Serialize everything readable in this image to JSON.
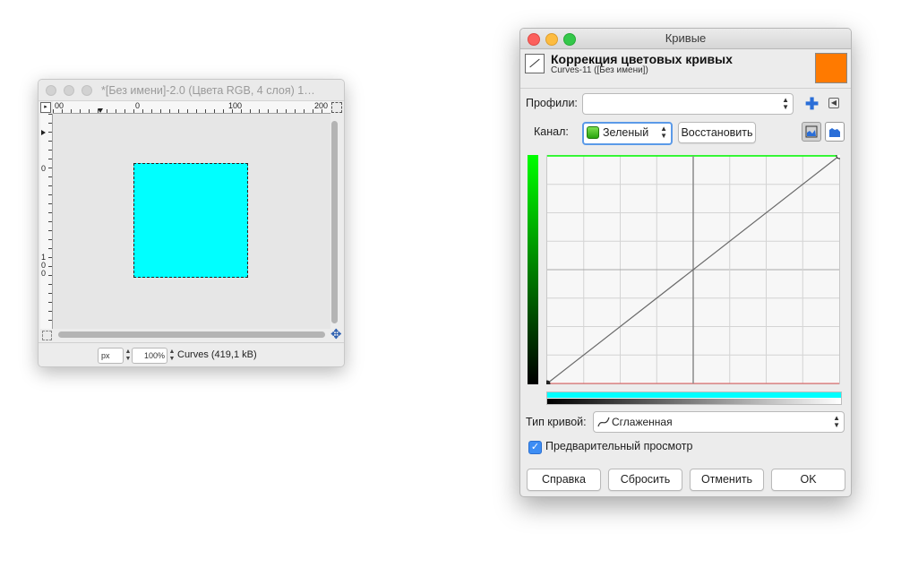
{
  "image_window": {
    "title": "*[Без имени]-2.0 (Цвета RGB, 4 слоя) 1…",
    "ruler_h": [
      "00",
      "0",
      "100",
      "200"
    ],
    "ruler_v": [
      "0",
      "1",
      "0",
      "0"
    ],
    "ruler_toggle": "▸",
    "unit": "px",
    "zoom": "100%",
    "status": "Curves (419,1 kB)",
    "layer_color": "#00ffff"
  },
  "curves_dialog": {
    "title": "Кривые",
    "header_title": "Коррекция цветовых кривых",
    "header_subtitle": "Curves-11 ([Без имени])",
    "fg_color": "#ff7a00",
    "presets_label": "Профили:",
    "presets_value": "",
    "channel_label": "Канал:",
    "channel_value": "Зеленый",
    "reset_channel_label": "Восстановить",
    "curve_type_label": "Тип кривой:",
    "curve_type_value": "Сглаженная",
    "preview_label": "Предварительный просмотр",
    "preview_checked": true,
    "buttons": {
      "help": "Справка",
      "reset": "Сбросить",
      "cancel": "Отменить",
      "ok": "OK"
    },
    "histogram_mode": "linear",
    "curve_points": [
      [
        0,
        0
      ],
      [
        255,
        255
      ]
    ],
    "channel_color": "#00ff00"
  }
}
